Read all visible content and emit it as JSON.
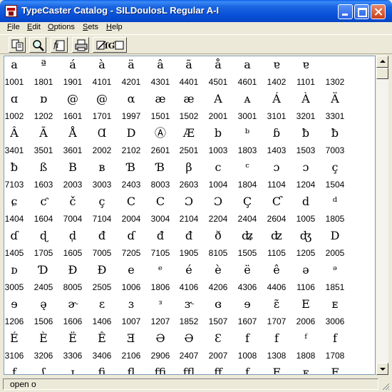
{
  "window": {
    "title": "TypeCaster Catalog - SILDoulosL Regular A-I"
  },
  "menu": [
    "File",
    "Edit",
    "Options",
    "Sets",
    "Help"
  ],
  "toolbar": {
    "icons": [
      "copy-icon",
      "search-icon",
      "font-properties-icon",
      "print-icon",
      "tools-icon"
    ]
  },
  "catalog": {
    "rows": [
      {
        "glyphs": [
          "a",
          "ª",
          "á",
          "à",
          "ä",
          "â",
          "ã",
          "å",
          "a",
          "ɐ",
          "ɐ"
        ],
        "codes": [
          "1001",
          "1801",
          "1901",
          "4101",
          "4201",
          "4301",
          "4401",
          "4501",
          "4601",
          "1402",
          "1101",
          "1302"
        ]
      },
      {
        "glyphs": [
          "ɑ",
          "ɒ",
          "@",
          "@",
          "α",
          "æ",
          "æ",
          "A",
          "ᴀ",
          "Á",
          "À",
          "Ä"
        ],
        "codes": [
          "1002",
          "1202",
          "1601",
          "1701",
          "1997",
          "1501",
          "1502",
          "2001",
          "3001",
          "3101",
          "3201",
          "3301"
        ]
      },
      {
        "glyphs": [
          "Â",
          "Ã",
          "Å",
          "Ɑ",
          "D",
          "Ⓐ",
          "Æ",
          "b",
          "ᵇ",
          "ɓ",
          "ƀ",
          "ƀ"
        ],
        "codes": [
          "3401",
          "3501",
          "3601",
          "2002",
          "2102",
          "2601",
          "2501",
          "1003",
          "1803",
          "1403",
          "1503",
          "7003"
        ]
      },
      {
        "glyphs": [
          "ƀ",
          "ß",
          "B",
          "ʙ",
          "Ɓ",
          "Ɓ",
          "β",
          "c",
          "ᶜ",
          "ɔ",
          "ɔ",
          "ç"
        ],
        "codes": [
          "7103",
          "1603",
          "2003",
          "3003",
          "2403",
          "8003",
          "2603",
          "1004",
          "1804",
          "1104",
          "1204",
          "1504"
        ]
      },
      {
        "glyphs": [
          "ɕ",
          "ƈ",
          "č",
          "ç",
          "C",
          "C",
          "Ɔ",
          "Ɔ",
          "Ç",
          "Ƈ",
          "d",
          "ᵈ"
        ],
        "codes": [
          "1404",
          "1604",
          "7004",
          "7104",
          "2004",
          "3004",
          "2104",
          "2204",
          "2404",
          "2604",
          "1005",
          "1805"
        ]
      },
      {
        "glyphs": [
          "ɗ",
          "ɖ",
          "ḍ",
          "đ",
          "ɗ",
          "đ",
          "đ",
          "ð",
          "ʥ",
          "ʣ",
          "ʤ",
          "D"
        ],
        "codes": [
          "1405",
          "1705",
          "1605",
          "7005",
          "7205",
          "7105",
          "1905",
          "8105",
          "1505",
          "1105",
          "1205",
          "2005"
        ]
      },
      {
        "glyphs": [
          "ᴅ",
          "Ɗ",
          "Đ",
          "Ɖ",
          "e",
          "ᵉ",
          "é",
          "è",
          "ë",
          "ê",
          "ə",
          "ᵊ"
        ],
        "codes": [
          "3005",
          "2405",
          "8005",
          "2505",
          "1006",
          "1806",
          "4106",
          "4206",
          "4306",
          "4406",
          "1106",
          "1851"
        ]
      },
      {
        "glyphs": [
          "ɘ",
          "ə̨",
          "ɚ",
          "ɛ",
          "ɜ",
          "ᵌ",
          "ɝ",
          "ɞ",
          "ɘ",
          "ɛ̃",
          "E",
          "ᴇ"
        ],
        "codes": [
          "1206",
          "1506",
          "1606",
          "1406",
          "1007",
          "1207",
          "1852",
          "1507",
          "1607",
          "1707",
          "2006",
          "3006"
        ]
      },
      {
        "glyphs": [
          "É",
          "È",
          "Ë",
          "Ê",
          "Ǝ",
          "Ə",
          "Ə",
          "Ɛ",
          "f",
          "f",
          "ᶠ",
          "f"
        ],
        "codes": [
          "3106",
          "3206",
          "3306",
          "3406",
          "2106",
          "2906",
          "2407",
          "2007",
          "1008",
          "1308",
          "1808",
          "1708"
        ]
      },
      {
        "glyphs": [
          "f",
          "ʃ",
          "ɪ",
          "ﬁ",
          "ﬂ",
          "ﬃ",
          "ﬄ",
          "ﬀ",
          "ƒ",
          "F",
          "ꜰ",
          "F"
        ],
        "codes": [
          "",
          "",
          "",
          "",
          "",
          "",
          "",
          "",
          "",
          "",
          "",
          ""
        ]
      }
    ]
  },
  "status": {
    "text": "open o"
  }
}
